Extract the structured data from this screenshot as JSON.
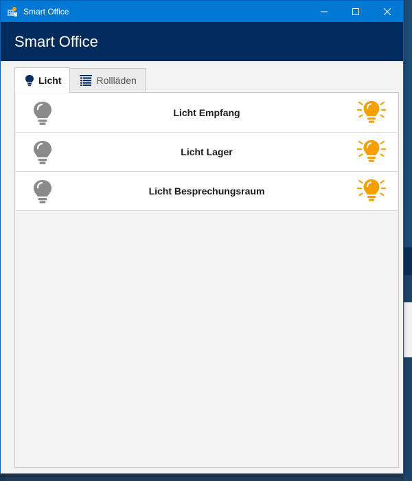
{
  "window": {
    "title": "Smart Office",
    "header_title": "Smart Office"
  },
  "tabs": [
    {
      "label": "Licht",
      "icon": "bulb-icon",
      "active": true
    },
    {
      "label": "Rollläden",
      "icon": "blinds-icon",
      "active": false
    }
  ],
  "lights": [
    {
      "label": "Licht Empfang"
    },
    {
      "label": "Licht Lager"
    },
    {
      "label": "Licht Besprechungsraum"
    }
  ],
  "colors": {
    "titlebar": "#0078d4",
    "header": "#002b5c",
    "bulb_off": "#8a8a8a",
    "bulb_on": "#f5a000"
  }
}
